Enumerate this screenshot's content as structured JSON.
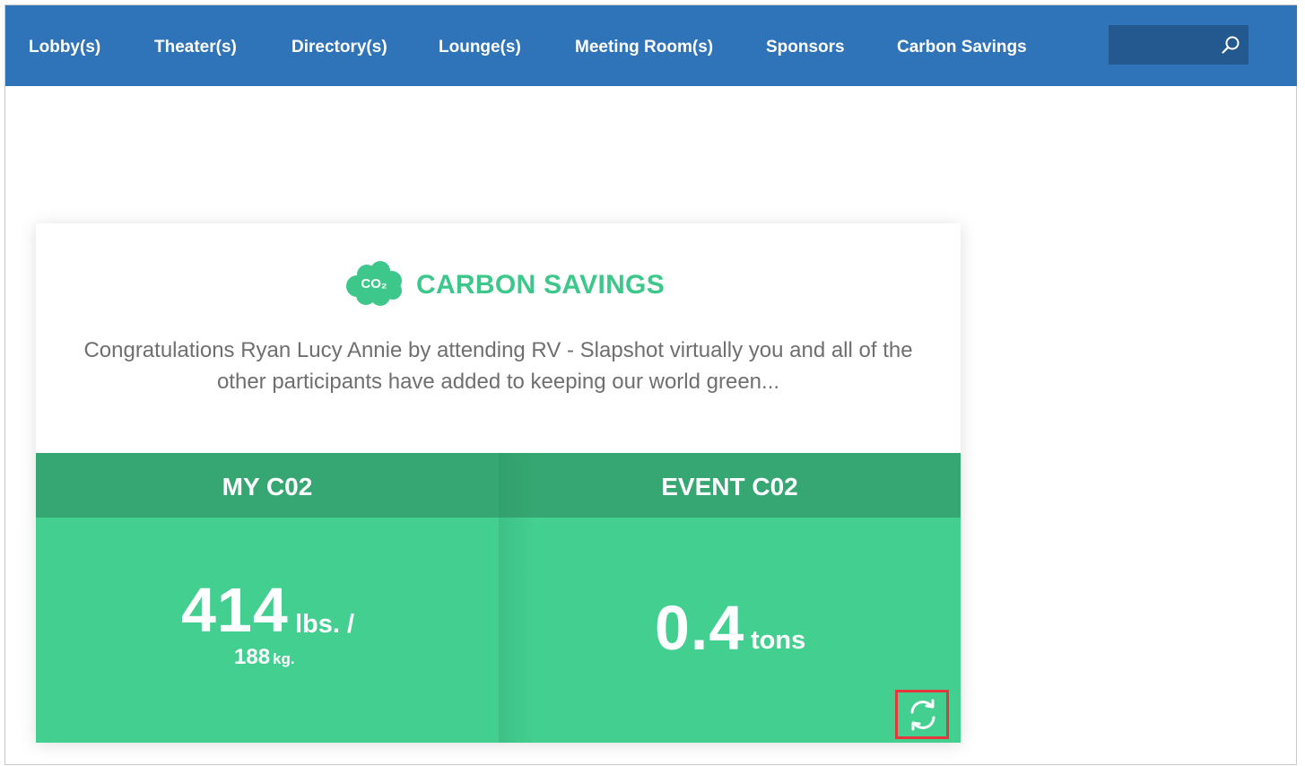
{
  "nav": {
    "items": [
      {
        "label": "Lobby(s)"
      },
      {
        "label": "Theater(s)"
      },
      {
        "label": "Directory(s)"
      },
      {
        "label": "Lounge(s)"
      },
      {
        "label": "Meeting Room(s)"
      },
      {
        "label": "Sponsors"
      },
      {
        "label": "Carbon Savings"
      }
    ],
    "search": {
      "value": "",
      "placeholder": "",
      "icon": "search-icon"
    }
  },
  "card": {
    "icon": "co2-cloud-icon",
    "icon_text": "CO₂",
    "title": "CARBON SAVINGS",
    "message": "Congratulations Ryan Lucy Annie by attending RV - Slapshot virtually you and all of the other participants have added to keeping our world green...",
    "my": {
      "header": "MY C02",
      "value": "414",
      "unit": "lbs. /",
      "value_kg": "188",
      "unit_kg": "kg."
    },
    "event": {
      "header": "EVENT C02",
      "value": "0.4",
      "unit": "tons"
    },
    "refresh_icon": "refresh-icon"
  },
  "colors": {
    "nav_bg": "#2f74b9",
    "search_bg": "#24598f",
    "accent_green": "#3ec78a",
    "stat_header": "#36a772",
    "stat_body": "#43cf90",
    "highlight": "#e5373c"
  }
}
